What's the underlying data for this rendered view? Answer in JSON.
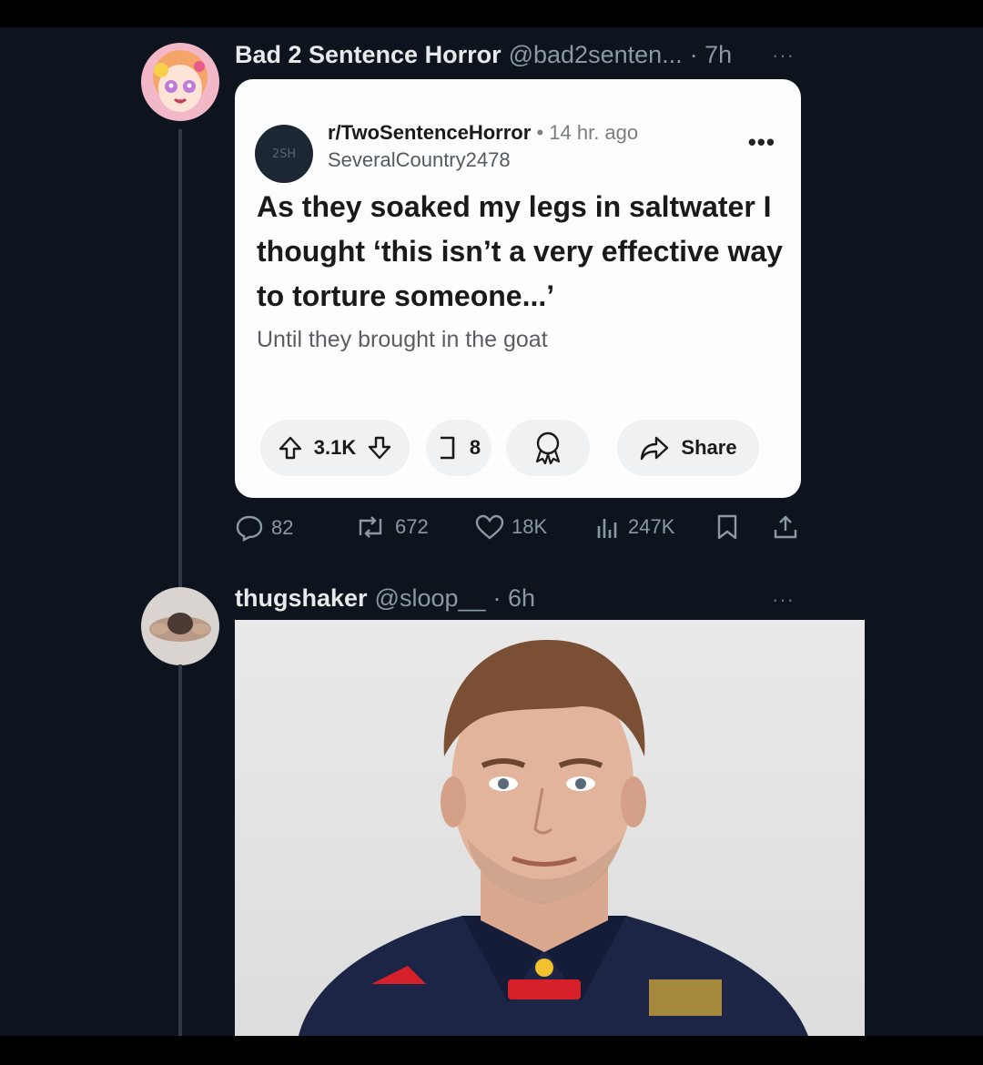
{
  "post1": {
    "author": "Bad 2 Sentence Horror",
    "handle": "@bad2senten...",
    "time": "· 7h",
    "more": "···",
    "card": {
      "subreddit": "r/TwoSentenceHorror",
      "separator": "•",
      "age": "14 hr. ago",
      "username": "SeveralCountry2478",
      "more": "•••",
      "title": "As they soaked my legs in saltwater I thought ‘this isn’t a very effective way to torture someone...’",
      "body": "Until they brought in the goat",
      "upvotes": "3.1K",
      "comments": "8",
      "share": "Share"
    },
    "stats": {
      "replies": "82",
      "reposts": "672",
      "likes": "18K",
      "views": "247K"
    }
  },
  "post2": {
    "author": "thugshaker",
    "handle": "@sloop__",
    "time": "· 6h",
    "more": "···"
  },
  "colors": {
    "background": "#0d141d",
    "card": "#fdfdfd",
    "muted": "#8b98a5",
    "thread_line": "#2f3a45"
  }
}
